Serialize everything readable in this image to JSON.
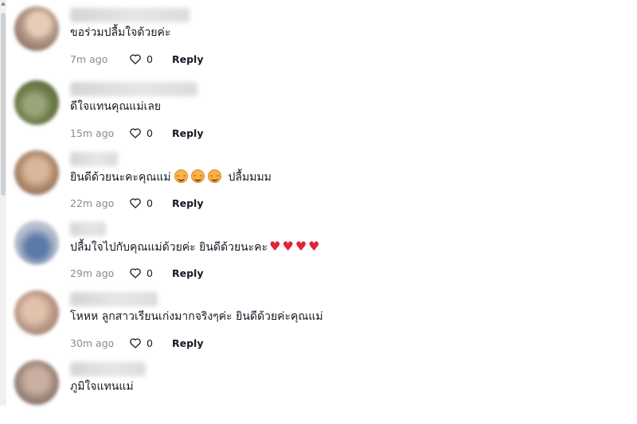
{
  "comments": [
    {
      "username": "**********",
      "text": "ขอร่วมปลื้มใจด้วยค่ะ",
      "time": "7m ago",
      "likes": "0",
      "reply": "Reply"
    },
    {
      "username": "**********",
      "text": "ดีใจแทนคุณแม่เลย",
      "time": "15m ago",
      "likes": "0",
      "reply": "Reply"
    },
    {
      "username": "**********",
      "text": "ยินดีด้วยนะคะคุณแม่",
      "text_suffix": "ปลื้มมมม",
      "emoji_icons": [
        "smiling-face-icon",
        "smiling-face-icon",
        "smiling-face-icon"
      ],
      "time": "22m ago",
      "likes": "0",
      "reply": "Reply"
    },
    {
      "username": "**********",
      "text": "ปลื้มใจไปกับคุณแม่ด้วยค่ะ ยินดีด้วยนะคะ",
      "heart_icons": [
        "red-heart-icon",
        "red-heart-icon",
        "red-heart-icon",
        "red-heart-icon"
      ],
      "time": "29m ago",
      "likes": "0",
      "reply": "Reply"
    },
    {
      "username": "**********",
      "text": "โหหห ลูกสาวเรียนเก่งมากจริงๆค่ะ ยินดีด้วยค่ะคุณแม่",
      "time": "30m ago",
      "likes": "0",
      "reply": "Reply"
    },
    {
      "username": "**********",
      "text": "ภูมิใจแทนแม่"
    }
  ],
  "colors": {
    "heart": "#e0243a",
    "timestamp": "#8a8b91",
    "text": "#161823"
  },
  "icons": {
    "like": "heart-outline-icon",
    "scroll_up": "scroll-up-arrow-icon"
  }
}
